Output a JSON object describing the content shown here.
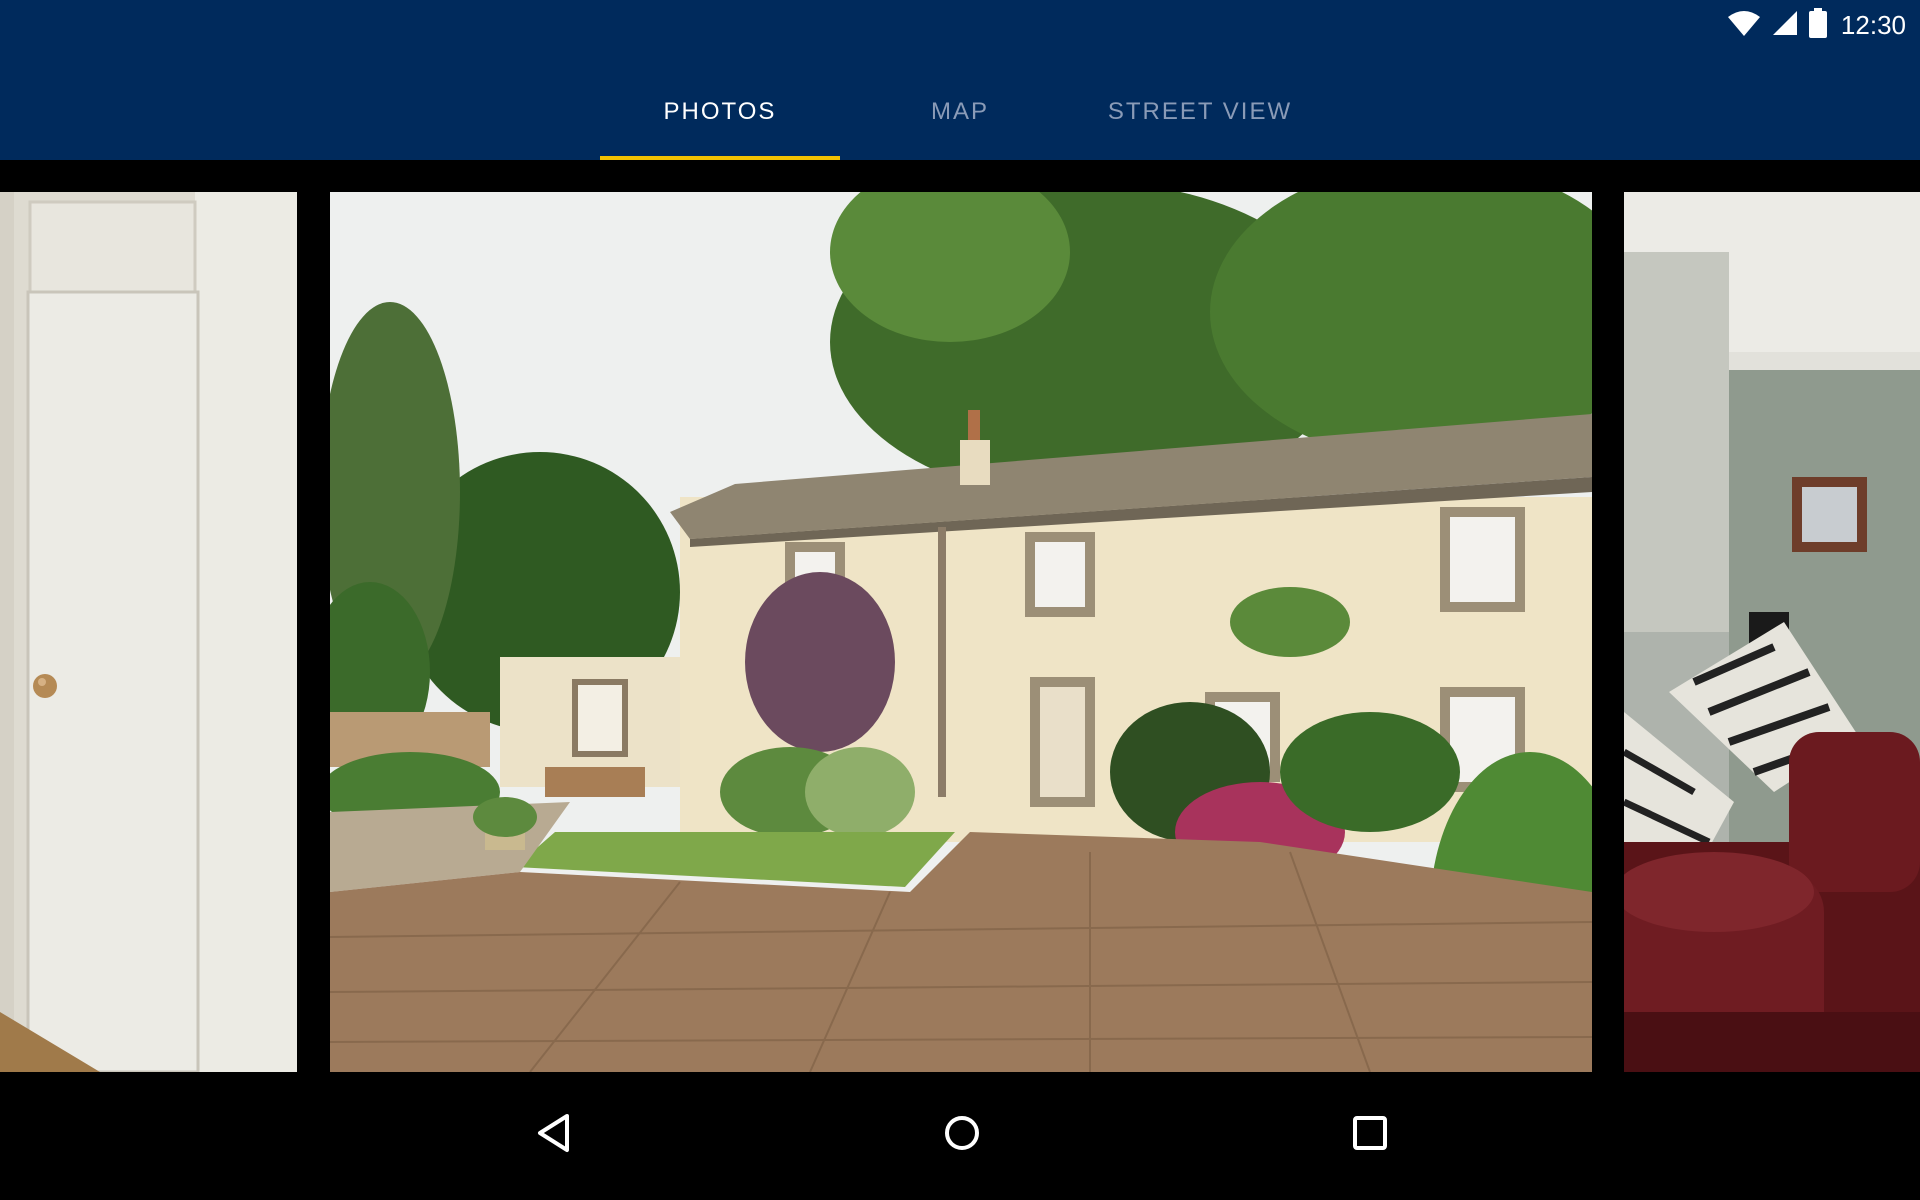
{
  "status_bar": {
    "time": "12:30",
    "icons": [
      "wifi-icon",
      "cell-signal-icon",
      "battery-icon"
    ]
  },
  "tabs": [
    {
      "label": "PHOTOS",
      "active": true
    },
    {
      "label": "MAP",
      "active": false
    },
    {
      "label": "STREET VIEW",
      "active": false
    }
  ],
  "gallery": {
    "photos": [
      {
        "subject": "white interior door with wooden knob"
      },
      {
        "subject": "cream stone cottage with courtyard garden and trees"
      },
      {
        "subject": "living room with burgundy leather sofa and zebra cushions"
      }
    ]
  },
  "nav_bar": {
    "icons": [
      "back-icon",
      "home-icon",
      "recents-icon"
    ]
  },
  "colors": {
    "header": "#002a5c",
    "tab_indicator": "#f2c100",
    "tab_active": "#ffffff",
    "tab_inactive": "#8a9bb7"
  }
}
